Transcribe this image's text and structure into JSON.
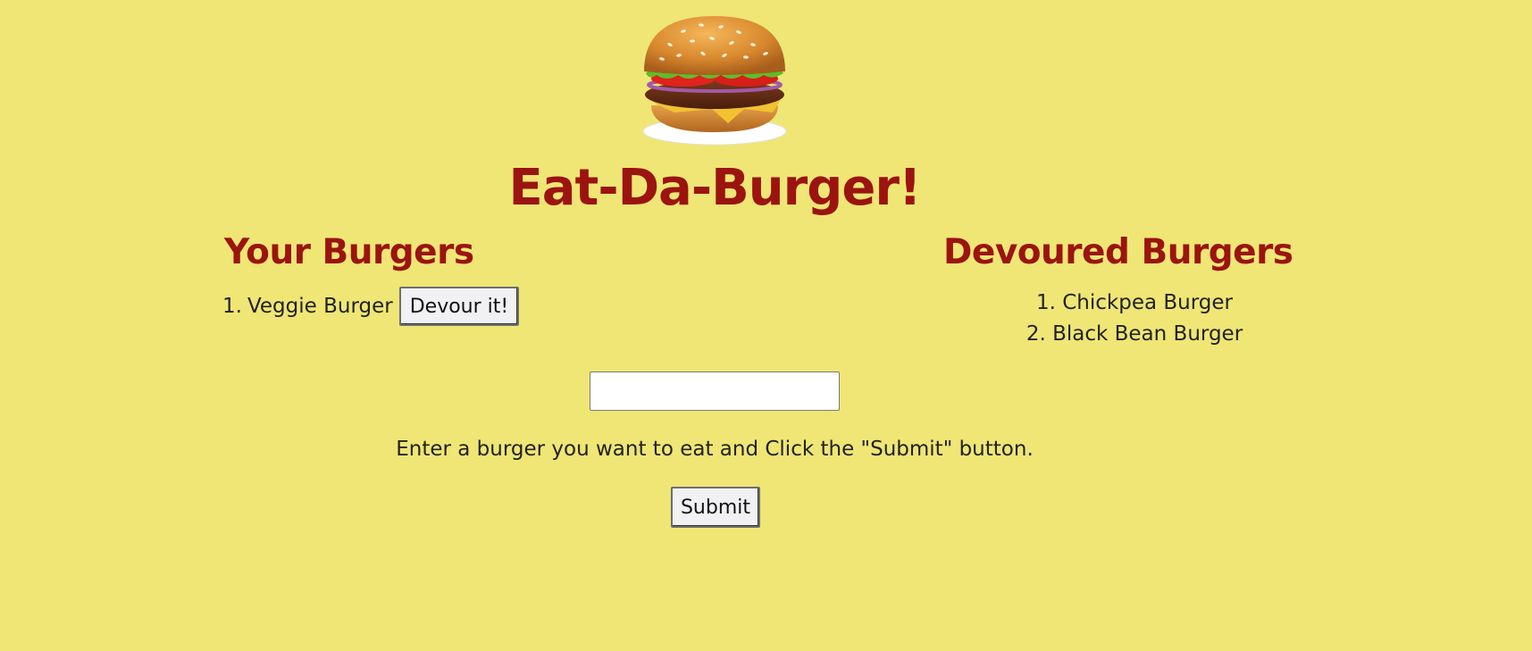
{
  "header": {
    "logo_icon": "hamburger-icon",
    "title": "Eat-Da-Burger!"
  },
  "your_burgers": {
    "heading": "Your Burgers",
    "items": [
      {
        "number": "1.",
        "name": "Veggie Burger",
        "button_label": "Devour it!"
      }
    ]
  },
  "devoured_burgers": {
    "heading": "Devoured Burgers",
    "items": [
      {
        "text": "1. Chickpea Burger"
      },
      {
        "text": "2. Black Bean Burger"
      }
    ]
  },
  "form": {
    "input_value": "",
    "input_placeholder": "",
    "instructions": "Enter a burger you want to eat and Click the \"Submit\" button.",
    "submit_label": "Submit"
  },
  "colors": {
    "background": "#efe675",
    "heading": "#9b1410",
    "text": "#222222"
  }
}
